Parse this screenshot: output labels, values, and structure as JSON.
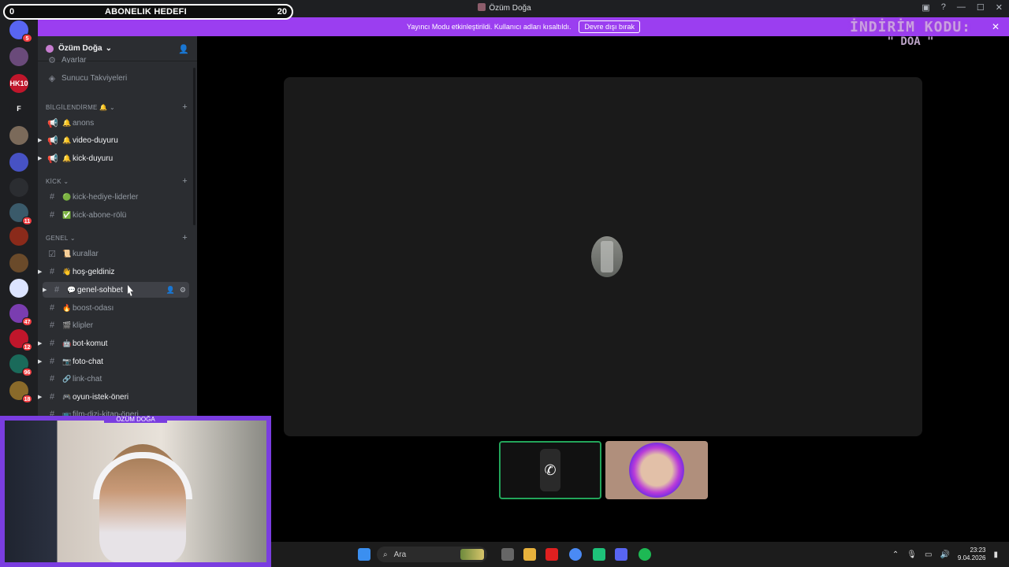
{
  "window": {
    "title": "Özüm Doğa"
  },
  "goal_overlay": {
    "left": "0",
    "title": "ABONELIK HEDEFI",
    "right": "20"
  },
  "banner": {
    "text": "Yayıncı Modu etkinleştirildi. Kullanıcı adları kısaltıldı.",
    "button": "Devre dışı bırak"
  },
  "discount_overlay": {
    "line1": "İNDİRİM KODU:",
    "line2": "\" DOA \""
  },
  "server": {
    "name": "Özüm Doğa",
    "partial_item": "Ayarlar",
    "boosts_label": "Sunucu Takviyeleri"
  },
  "servers": [
    {
      "label": "",
      "badge": "5",
      "color": "#5865f2"
    },
    {
      "label": "",
      "badge": "",
      "color": "#6a4a7a"
    },
    {
      "label": "HK10",
      "badge": "",
      "color": "#c0162b"
    },
    {
      "label": "F",
      "badge": "",
      "color": "#1e1f22"
    },
    {
      "label": "",
      "badge": "",
      "color": "#7b6a5a"
    },
    {
      "label": "",
      "badge": "",
      "color": "#4752c4"
    },
    {
      "label": "",
      "badge": "",
      "color": "#2b2d31"
    },
    {
      "label": "",
      "badge": "11",
      "color": "#3a5a6a"
    },
    {
      "label": "",
      "badge": "",
      "color": "#8a2a1a"
    },
    {
      "label": "",
      "badge": "",
      "color": "#6a4a2a"
    },
    {
      "label": "",
      "badge": "",
      "color": "#dce4ff"
    },
    {
      "label": "",
      "badge": "47",
      "color": "#7a3db0"
    },
    {
      "label": "",
      "badge": "12",
      "color": "#c0162b"
    },
    {
      "label": "",
      "badge": "96",
      "color": "#1a6a5a"
    },
    {
      "label": "",
      "badge": "18",
      "color": "#8a6a2a"
    }
  ],
  "categories": {
    "notify": "BİLGİLENDİRME 🔔",
    "kick": "KİCK",
    "general": "GENEL"
  },
  "channels": [
    {
      "emoji": "🔔",
      "name": "anons",
      "unread": false
    },
    {
      "emoji": "🔔",
      "name": "video-duyuru",
      "unread": true
    },
    {
      "emoji": "🔔",
      "name": "kick-duyuru",
      "unread": true
    },
    {
      "emoji": "🟢",
      "name": "kick-hediye-liderler",
      "unread": false
    },
    {
      "emoji": "✅",
      "name": "kick-abone-rölü",
      "unread": false
    },
    {
      "emoji": "📜",
      "name": "kurallar",
      "unread": false
    },
    {
      "emoji": "👋",
      "name": "hoş-geldiniz",
      "unread": true
    },
    {
      "emoji": "💬",
      "name": "genel-sohbet",
      "unread": true
    },
    {
      "emoji": "🔥",
      "name": "boost-odası",
      "unread": false
    },
    {
      "emoji": "🎬",
      "name": "klipler",
      "unread": false
    },
    {
      "emoji": "🤖",
      "name": "bot-komut",
      "unread": true
    },
    {
      "emoji": "📷",
      "name": "foto-chat",
      "unread": true
    },
    {
      "emoji": "🔗",
      "name": "link-chat",
      "unread": false
    },
    {
      "emoji": "🎮",
      "name": "oyun-istek-öneri",
      "unread": true
    },
    {
      "emoji": "📺",
      "name": "film-dizi-kitap-öneri",
      "unread": false
    }
  ],
  "webcam": {
    "name": "ÖZÜM DOĞA"
  },
  "taskbar": {
    "search": "Ara",
    "time": "23:23",
    "date": "9.04.2026"
  },
  "colors": {
    "accent": "#9b3ef0",
    "online": "#23a55a",
    "sidebar": "#2b2d31"
  }
}
